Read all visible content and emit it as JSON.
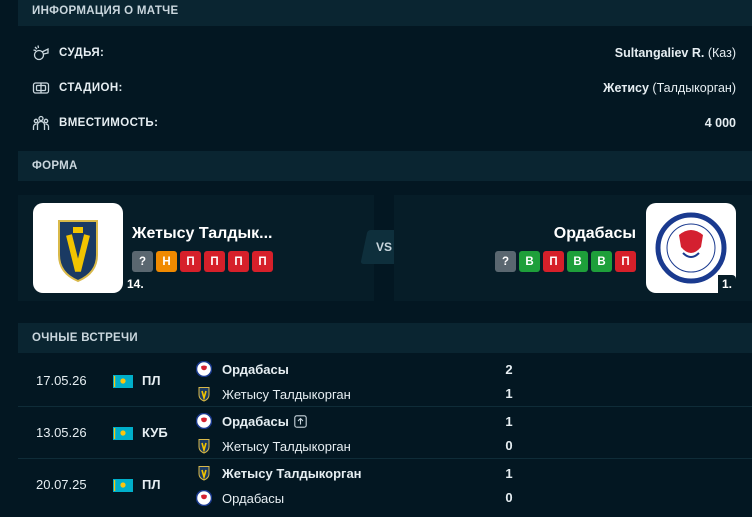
{
  "match_info": {
    "title": "ИНФОРМАЦИЯ О МАТЧЕ",
    "rows": [
      {
        "label": "СУДЬЯ:",
        "value": "Sultangaliev R.",
        "value_extra": "(Каз)",
        "icon": "whistle-icon"
      },
      {
        "label": "СТАДИОН:",
        "value": "Жетису",
        "value_extra": "(Талдыкорган)",
        "icon": "stadium-icon"
      },
      {
        "label": "ВМЕСТИМОСТЬ:",
        "value": "4 000",
        "value_extra": "",
        "icon": "crowd-icon"
      }
    ]
  },
  "form": {
    "title": "ФОРМА",
    "vs_label": "VS",
    "home": {
      "name": "Жетысу Талдык...",
      "rank": "14.",
      "results": [
        "?",
        "Н",
        "П",
        "П",
        "П",
        "П"
      ]
    },
    "away": {
      "name": "Ордабасы",
      "rank": "1.",
      "results": [
        "?",
        "В",
        "П",
        "В",
        "В",
        "П"
      ]
    }
  },
  "h2h": {
    "title": "ОЧНЫЕ ВСТРЕЧИ",
    "matches": [
      {
        "date": "17.05.26",
        "competition": "ПЛ",
        "team1": "Ордабасы",
        "team1_bold": true,
        "score1": "2",
        "team2": "Жетысу Талдыкорган",
        "team2_bold": false,
        "score2": "1"
      },
      {
        "date": "13.05.26",
        "competition": "КУБ",
        "team1": "Ордабасы",
        "team1_bold": true,
        "score1": "1",
        "team1_badge": "advance-icon",
        "team2": "Жетысу Талдыкорган",
        "team2_bold": false,
        "score2": "0"
      },
      {
        "date": "20.07.25",
        "competition": "ПЛ",
        "team1": "Жетысу Талдыкорган",
        "team1_bold": true,
        "score1": "1",
        "team2": "Ордабасы",
        "team2_bold": false,
        "score2": "0"
      }
    ]
  },
  "colors": {
    "background": "#031722",
    "section_header": "#0a2531",
    "win": "#1e9f3a",
    "loss": "#d6202a",
    "draw": "#f08a00",
    "unknown": "#5a6770"
  }
}
